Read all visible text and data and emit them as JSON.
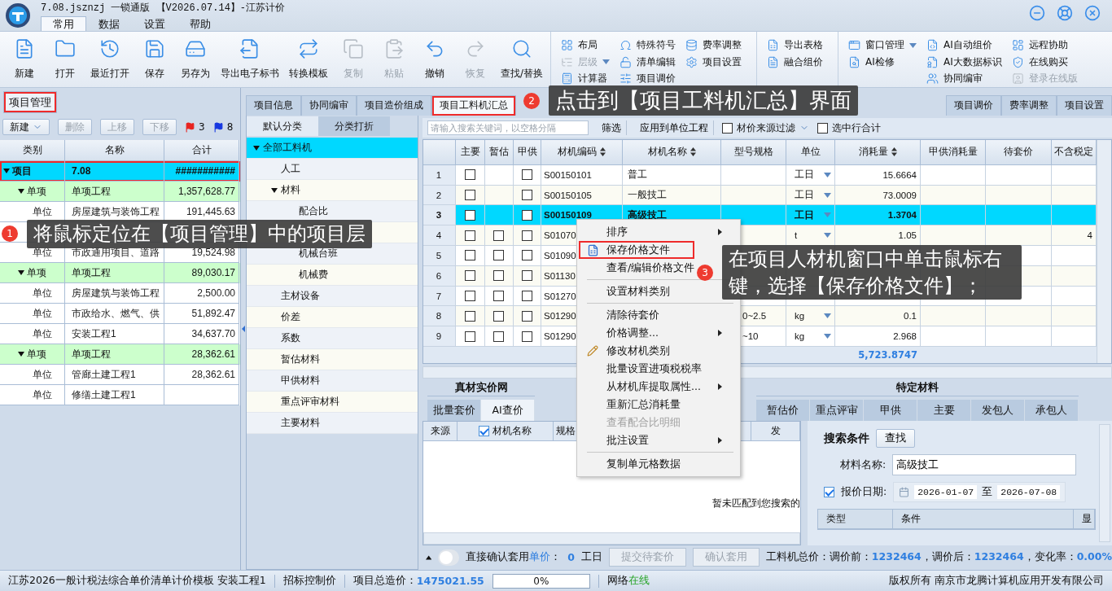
{
  "window": {
    "title": "7.08.jsznzj 一锁通版 【V2026.07.14】-江苏计价"
  },
  "menu_tabs": [
    {
      "label": "常用",
      "selected": true
    },
    {
      "label": "数据",
      "selected": false
    },
    {
      "label": "设置",
      "selected": false
    },
    {
      "label": "帮助",
      "selected": false
    }
  ],
  "toolbar": {
    "large_buttons": [
      {
        "label": "新建",
        "disabled": false
      },
      {
        "label": "打开",
        "disabled": false
      },
      {
        "label": "最近打开",
        "disabled": false
      },
      {
        "label": "保存",
        "disabled": false
      },
      {
        "label": "另存为",
        "disabled": false
      },
      {
        "label": "导出电子标书",
        "disabled": false
      },
      {
        "label": "转换模板",
        "disabled": false
      },
      {
        "label": "复制",
        "disabled": true
      },
      {
        "label": "粘贴",
        "disabled": true
      },
      {
        "label": "撤销",
        "disabled": false
      },
      {
        "label": "恢复",
        "disabled": true
      },
      {
        "label": "查找/替换",
        "disabled": false
      }
    ],
    "small_groups": [
      [
        [
          {
            "label": "布局",
            "disabled": false
          },
          {
            "label": "层级",
            "disabled": true,
            "dropdown": true
          },
          {
            "label": "计算器",
            "disabled": false
          }
        ],
        [
          {
            "label": "特殊符号",
            "disabled": false
          },
          {
            "label": "清单编辑",
            "disabled": false
          },
          {
            "label": "项目调价",
            "disabled": false
          }
        ],
        [
          {
            "label": "费率调整",
            "disabled": false
          },
          {
            "label": "项目设置",
            "disabled": false
          }
        ]
      ],
      [
        [
          {
            "label": "导出表格",
            "disabled": false
          },
          {
            "label": "融合组价",
            "disabled": false
          }
        ]
      ],
      [
        [
          {
            "label": "窗口管理",
            "disabled": false,
            "dropdown": true
          },
          {
            "label": "AI检修",
            "disabled": false
          }
        ],
        [
          {
            "label": "AI自动组价",
            "disabled": false
          },
          {
            "label": "AI大数据标识",
            "disabled": false
          },
          {
            "label": "协同编审",
            "disabled": false
          }
        ],
        [
          {
            "label": "远程协助",
            "disabled": false
          },
          {
            "label": "在线购买",
            "disabled": false
          },
          {
            "label": "登录在线版",
            "disabled": true
          }
        ]
      ]
    ]
  },
  "project_panel": {
    "tab": {
      "label": "项目管理",
      "selected": true,
      "highlighted": true
    },
    "buttons": [
      {
        "label": "新建",
        "disabled": false,
        "dropdown": true
      },
      {
        "label": "删除",
        "disabled": true
      },
      {
        "label": "上移",
        "disabled": true
      },
      {
        "label": "下移",
        "disabled": true
      }
    ],
    "flags": [
      {
        "color": "#e8231f",
        "count": "3"
      },
      {
        "color": "#1537e0",
        "count": "8"
      }
    ],
    "columns": [
      "类别",
      "名称",
      "合计"
    ],
    "rows": [
      {
        "kind": "project",
        "category": "项目",
        "name": "7.08",
        "total": "###########",
        "selected": true,
        "highlighted": true,
        "expanded": true,
        "children": [
          {
            "kind": "item",
            "category": "单项",
            "name": "单项工程",
            "total": "1,357,628.77",
            "selected": false,
            "expanded": true,
            "children": [
              {
                "kind": "unit",
                "category": "单位",
                "name": "房屋建筑与装饰工程",
                "total": "191,445.63",
                "selected": false
              },
              {
                "kind": "unit"
              },
              {
                "kind": "unit",
                "category": "单位",
                "name": "市政通用项目、道路",
                "total": "19,524.98",
                "selected": false
              }
            ]
          },
          {
            "kind": "item",
            "category": "单项",
            "name": "单项工程",
            "total": "89,030.17",
            "selected": false,
            "expanded": true,
            "children": [
              {
                "kind": "unit",
                "category": "单位",
                "name": "房屋建筑与装饰工程",
                "total": "2,500.00",
                "selected": false
              },
              {
                "kind": "unit",
                "category": "单位",
                "name": "市政给水、燃气、供",
                "total": "51,892.47",
                "selected": false
              },
              {
                "kind": "unit",
                "category": "单位",
                "name": "安装工程1",
                "total": "34,637.70",
                "selected": false
              }
            ]
          },
          {
            "kind": "item",
            "category": "单项",
            "name": "单项工程",
            "total": "28,362.61",
            "selected": false,
            "expanded": true,
            "children": [
              {
                "kind": "unit",
                "category": "单位",
                "name": "管廊土建工程1",
                "total": "28,362.61",
                "selected": false
              },
              {
                "kind": "unit",
                "category": "单位",
                "name": "修缮土建工程1",
                "selected": false
              }
            ]
          }
        ]
      }
    ]
  },
  "main_tabs": [
    {
      "label": "项目信息",
      "selected": false
    },
    {
      "label": "协同编审",
      "selected": false
    },
    {
      "label": "项目造价组成",
      "selected": false
    },
    {
      "label": "项目工料机汇总",
      "selected": true,
      "highlighted": true
    }
  ],
  "right_tabs": [
    {
      "label": "项目调价",
      "selected": false
    },
    {
      "label": "费率调整",
      "selected": false
    },
    {
      "label": "项目设置",
      "selected": false
    }
  ],
  "category_tabs": [
    {
      "label": "默认分类",
      "selected": true
    },
    {
      "label": "分类打折",
      "selected": false
    }
  ],
  "material_tree": [
    {
      "label": "全部工料机",
      "selected": true,
      "expanded": true,
      "children": [
        {
          "label": "人工",
          "selected": false
        },
        {
          "label": "材料",
          "selected": false,
          "expanded": true,
          "children": [
            {
              "label": "配合比",
              "selected": false
            }
          ]
        },
        {
          "selected": false,
          "expanded": true,
          "children": [
            {
              "label": "机械台班",
              "selected": false
            },
            {
              "label": "机械费",
              "selected": false
            }
          ]
        },
        {
          "label": "主材设备",
          "selected": false
        },
        {
          "label": "价差",
          "selected": false
        },
        {
          "label": "系数",
          "selected": false
        },
        {
          "label": "暂估材料",
          "selected": false
        },
        {
          "label": "甲供材料",
          "selected": false
        },
        {
          "label": "重点评审材料",
          "selected": false
        },
        {
          "label": "主要材料",
          "selected": false
        }
      ]
    }
  ],
  "filter_bar": {
    "search_placeholder": "请输入搜索关键词，以空格分隔",
    "buttons": [
      "筛选",
      "应用到单位工程"
    ],
    "source_filter": {
      "label": "材价来源过滤",
      "checked": false
    },
    "sum_selected": {
      "label": "选中行合计",
      "checked": false
    }
  },
  "grid": {
    "columns": [
      {
        "label": "主要"
      },
      {
        "label": "暂估"
      },
      {
        "label": "甲供"
      },
      {
        "label": "材机编码",
        "sortable": true
      },
      {
        "label": "材机名称",
        "sortable": true
      },
      {
        "label": "型号规格"
      },
      {
        "label": "单位"
      },
      {
        "label": "消耗量",
        "sortable": true
      },
      {
        "label": "甲供消耗量"
      },
      {
        "label": "待套价"
      },
      {
        "label": "不含税定"
      }
    ],
    "rows": [
      {
        "index": "1",
        "main": false,
        "supplied": false,
        "code": "S00150101",
        "name": "普工",
        "unit": "工日",
        "quantity": "15.6664",
        "selected": false
      },
      {
        "index": "2",
        "main": false,
        "supplied": false,
        "code": "S00150105",
        "name": "一般技工",
        "unit": "工日",
        "quantity": "73.0009",
        "selected": false
      },
      {
        "index": "3",
        "main": false,
        "supplied": false,
        "code": "S00150109",
        "name": "高级技工",
        "unit": "工日",
        "quantity": "1.3704",
        "selected": true
      },
      {
        "index": "4",
        "main": false,
        "provisional": false,
        "supplied": false,
        "code": "S01070",
        "unit": "t",
        "quantity": "1.05",
        "extra": "4",
        "selected": false
      },
      {
        "index": "5",
        "main": false,
        "provisional": false,
        "supplied": false,
        "code": "S01090",
        "selected": false
      },
      {
        "index": "6",
        "main": false,
        "provisional": false,
        "supplied": false,
        "code": "S01130",
        "selected": false
      },
      {
        "index": "7",
        "main": false,
        "provisional": false,
        "supplied": false,
        "code": "S01270",
        "selected": false
      },
      {
        "index": "8",
        "main": false,
        "provisional": false,
        "supplied": false,
        "code": "S01290",
        "spec": "0~2.5",
        "unit": "kg",
        "quantity": "0.1",
        "selected": false
      },
      {
        "index": "9",
        "main": false,
        "provisional": false,
        "supplied": false,
        "code": "S01290",
        "spec": "~10",
        "unit": "kg",
        "quantity": "2.968",
        "selected": false
      }
    ],
    "total_quantity": "5,723.8747"
  },
  "context_menu": [
    {
      "kind": "item",
      "label": "排序",
      "submenu": true,
      "disabled": false
    },
    {
      "kind": "item",
      "label": "保存价格文件",
      "has_icon": true,
      "highlighted": true,
      "disabled": false
    },
    {
      "kind": "item",
      "label": "查看/编辑价格文件",
      "disabled": false
    },
    {
      "kind": "separator"
    },
    {
      "kind": "item",
      "label": "设置材料类别",
      "disabled": false
    },
    {
      "kind": "separator"
    },
    {
      "kind": "item",
      "label": "清除待套价",
      "disabled": false
    },
    {
      "kind": "item",
      "label": "价格调整...",
      "submenu": true,
      "disabled": false
    },
    {
      "kind": "item",
      "label": "修改材机类别",
      "has_icon": true,
      "disabled": false
    },
    {
      "kind": "item",
      "label": "批量设置进项税税率",
      "disabled": false
    },
    {
      "kind": "item",
      "label": "从材机库提取属性...",
      "submenu": true,
      "disabled": false
    },
    {
      "kind": "item",
      "label": "重新汇总消耗量",
      "disabled": false
    },
    {
      "kind": "item",
      "label": "查看配合比明细",
      "disabled": true
    },
    {
      "kind": "item",
      "label": "批注设置",
      "submenu": true,
      "disabled": false
    },
    {
      "kind": "separator"
    },
    {
      "kind": "item",
      "label": "复制单元格数据",
      "disabled": false
    }
  ],
  "price_net": {
    "title": "真材实价网",
    "tabs": [
      {
        "label": "批量套价",
        "selected": false
      },
      {
        "label": "AI查价",
        "selected": true
      }
    ],
    "columns": [
      {
        "label": "来源"
      },
      {
        "label": "材机名称",
        "checked": true
      },
      {
        "label": "规格"
      },
      {
        "label": "发"
      }
    ],
    "empty_message": "暂未匹配到您搜索的"
  },
  "special_materials": {
    "title": "特定材料",
    "tabs": [
      {
        "label": "暂估价",
        "selected": false
      },
      {
        "label": "重点评审",
        "selected": false
      },
      {
        "label": "甲供",
        "selected": false
      },
      {
        "label": "主要",
        "selected": false
      },
      {
        "label": "发包人",
        "selected": false
      },
      {
        "label": "承包人",
        "selected": false
      }
    ]
  },
  "search_panel": {
    "title": "搜索条件",
    "button": "查找",
    "name_label": "材料名称:",
    "name_value": "高级技工",
    "date_label": "报价日期:",
    "date_checked": true,
    "date_from": "2026-01-07",
    "date_separator": "至",
    "date_to": "2026-07-08",
    "columns": [
      "类型",
      "条件",
      "显"
    ]
  },
  "bottom_bar": {
    "toggle_on": false,
    "confirm_prefix": "直接确认套用",
    "confirm_link": "单价",
    "confirm_suffix": "：",
    "count": "0",
    "count_unit": "工日",
    "buttons": [
      {
        "label": "提交待套价",
        "disabled": true
      },
      {
        "label": "确认套用",
        "disabled": true
      }
    ],
    "totals": [
      {
        "kind": "text",
        "text": "工料机总价：调价前："
      },
      {
        "kind": "value",
        "text": "1232464"
      },
      {
        "kind": "text",
        "text": "，调价后："
      },
      {
        "kind": "value",
        "text": "1232464"
      },
      {
        "kind": "text",
        "text": "，变化率："
      },
      {
        "kind": "value",
        "text": "0.00%"
      }
    ]
  },
  "status_bar": {
    "template": "江苏2026一般计税法综合单价清单计价模板 安装工程1",
    "bid_type": "招标控制价",
    "total_label": "项目总造价：",
    "total_value": "1475021.55",
    "progress": {
      "level": 0,
      "text": "0%"
    },
    "network_label": "网络",
    "network_state": "在线",
    "copyright": "版权所有 南京市龙腾计算机应用开发有限公司"
  },
  "callouts": [
    {
      "number": "1",
      "text": "将鼠标定位在【项目管理】中的项目层"
    },
    {
      "number": "2",
      "text": "点击到【项目工料机汇总】界面"
    },
    {
      "number": "3",
      "text": "在项目人材机窗口中单击鼠标右键，选择【保存价格文件】；"
    }
  ]
}
